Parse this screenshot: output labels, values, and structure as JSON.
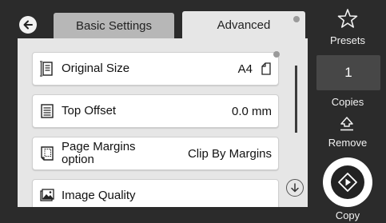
{
  "tabs": [
    {
      "label": "Basic Settings",
      "active": false
    },
    {
      "label": "Advanced",
      "active": true
    }
  ],
  "settings": [
    {
      "label": "Original Size",
      "value": "A4",
      "icon": "original-size-icon"
    },
    {
      "label": "Top Offset",
      "value": "0.0 mm",
      "icon": "document-lines-icon"
    },
    {
      "label": "Page Margins option",
      "label_line1": "Page Margins",
      "label_line2": "option",
      "value": "Clip By Margins",
      "icon": "page-margins-icon"
    },
    {
      "label": "Image Quality",
      "value": "",
      "icon": "image-quality-icon"
    }
  ],
  "sidebar": {
    "presets_label": "Presets",
    "copies_value": "1",
    "copies_label": "Copies",
    "remove_label": "Remove",
    "copy_label": "Copy"
  },
  "colors": {
    "background": "#2b2b2b",
    "panel": "#e6e6e6",
    "inactive_tab": "#b7b7b7",
    "copies_box": "#474747"
  }
}
